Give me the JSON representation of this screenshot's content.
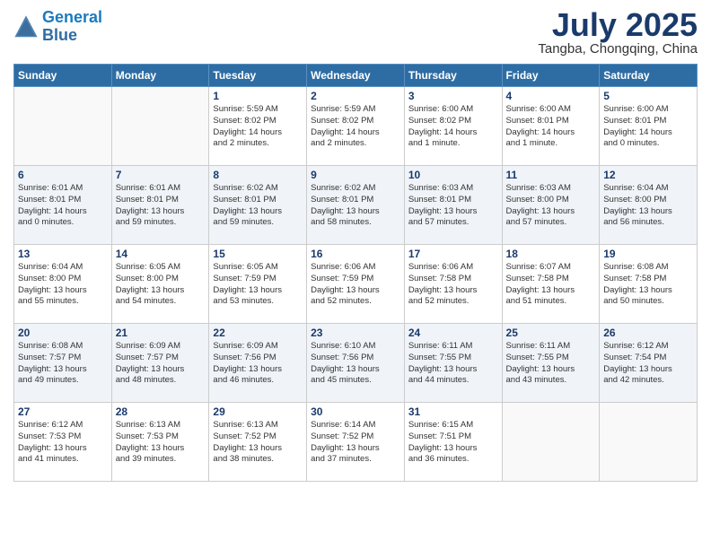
{
  "logo": {
    "line1": "General",
    "line2": "Blue"
  },
  "title": "July 2025",
  "location": "Tangba, Chongqing, China",
  "weekdays": [
    "Sunday",
    "Monday",
    "Tuesday",
    "Wednesday",
    "Thursday",
    "Friday",
    "Saturday"
  ],
  "weeks": [
    [
      {
        "day": "",
        "info": ""
      },
      {
        "day": "",
        "info": ""
      },
      {
        "day": "1",
        "info": "Sunrise: 5:59 AM\nSunset: 8:02 PM\nDaylight: 14 hours\nand 2 minutes."
      },
      {
        "day": "2",
        "info": "Sunrise: 5:59 AM\nSunset: 8:02 PM\nDaylight: 14 hours\nand 2 minutes."
      },
      {
        "day": "3",
        "info": "Sunrise: 6:00 AM\nSunset: 8:02 PM\nDaylight: 14 hours\nand 1 minute."
      },
      {
        "day": "4",
        "info": "Sunrise: 6:00 AM\nSunset: 8:01 PM\nDaylight: 14 hours\nand 1 minute."
      },
      {
        "day": "5",
        "info": "Sunrise: 6:00 AM\nSunset: 8:01 PM\nDaylight: 14 hours\nand 0 minutes."
      }
    ],
    [
      {
        "day": "6",
        "info": "Sunrise: 6:01 AM\nSunset: 8:01 PM\nDaylight: 14 hours\nand 0 minutes."
      },
      {
        "day": "7",
        "info": "Sunrise: 6:01 AM\nSunset: 8:01 PM\nDaylight: 13 hours\nand 59 minutes."
      },
      {
        "day": "8",
        "info": "Sunrise: 6:02 AM\nSunset: 8:01 PM\nDaylight: 13 hours\nand 59 minutes."
      },
      {
        "day": "9",
        "info": "Sunrise: 6:02 AM\nSunset: 8:01 PM\nDaylight: 13 hours\nand 58 minutes."
      },
      {
        "day": "10",
        "info": "Sunrise: 6:03 AM\nSunset: 8:01 PM\nDaylight: 13 hours\nand 57 minutes."
      },
      {
        "day": "11",
        "info": "Sunrise: 6:03 AM\nSunset: 8:00 PM\nDaylight: 13 hours\nand 57 minutes."
      },
      {
        "day": "12",
        "info": "Sunrise: 6:04 AM\nSunset: 8:00 PM\nDaylight: 13 hours\nand 56 minutes."
      }
    ],
    [
      {
        "day": "13",
        "info": "Sunrise: 6:04 AM\nSunset: 8:00 PM\nDaylight: 13 hours\nand 55 minutes."
      },
      {
        "day": "14",
        "info": "Sunrise: 6:05 AM\nSunset: 8:00 PM\nDaylight: 13 hours\nand 54 minutes."
      },
      {
        "day": "15",
        "info": "Sunrise: 6:05 AM\nSunset: 7:59 PM\nDaylight: 13 hours\nand 53 minutes."
      },
      {
        "day": "16",
        "info": "Sunrise: 6:06 AM\nSunset: 7:59 PM\nDaylight: 13 hours\nand 52 minutes."
      },
      {
        "day": "17",
        "info": "Sunrise: 6:06 AM\nSunset: 7:58 PM\nDaylight: 13 hours\nand 52 minutes."
      },
      {
        "day": "18",
        "info": "Sunrise: 6:07 AM\nSunset: 7:58 PM\nDaylight: 13 hours\nand 51 minutes."
      },
      {
        "day": "19",
        "info": "Sunrise: 6:08 AM\nSunset: 7:58 PM\nDaylight: 13 hours\nand 50 minutes."
      }
    ],
    [
      {
        "day": "20",
        "info": "Sunrise: 6:08 AM\nSunset: 7:57 PM\nDaylight: 13 hours\nand 49 minutes."
      },
      {
        "day": "21",
        "info": "Sunrise: 6:09 AM\nSunset: 7:57 PM\nDaylight: 13 hours\nand 48 minutes."
      },
      {
        "day": "22",
        "info": "Sunrise: 6:09 AM\nSunset: 7:56 PM\nDaylight: 13 hours\nand 46 minutes."
      },
      {
        "day": "23",
        "info": "Sunrise: 6:10 AM\nSunset: 7:56 PM\nDaylight: 13 hours\nand 45 minutes."
      },
      {
        "day": "24",
        "info": "Sunrise: 6:11 AM\nSunset: 7:55 PM\nDaylight: 13 hours\nand 44 minutes."
      },
      {
        "day": "25",
        "info": "Sunrise: 6:11 AM\nSunset: 7:55 PM\nDaylight: 13 hours\nand 43 minutes."
      },
      {
        "day": "26",
        "info": "Sunrise: 6:12 AM\nSunset: 7:54 PM\nDaylight: 13 hours\nand 42 minutes."
      }
    ],
    [
      {
        "day": "27",
        "info": "Sunrise: 6:12 AM\nSunset: 7:53 PM\nDaylight: 13 hours\nand 41 minutes."
      },
      {
        "day": "28",
        "info": "Sunrise: 6:13 AM\nSunset: 7:53 PM\nDaylight: 13 hours\nand 39 minutes."
      },
      {
        "day": "29",
        "info": "Sunrise: 6:13 AM\nSunset: 7:52 PM\nDaylight: 13 hours\nand 38 minutes."
      },
      {
        "day": "30",
        "info": "Sunrise: 6:14 AM\nSunset: 7:52 PM\nDaylight: 13 hours\nand 37 minutes."
      },
      {
        "day": "31",
        "info": "Sunrise: 6:15 AM\nSunset: 7:51 PM\nDaylight: 13 hours\nand 36 minutes."
      },
      {
        "day": "",
        "info": ""
      },
      {
        "day": "",
        "info": ""
      }
    ]
  ]
}
